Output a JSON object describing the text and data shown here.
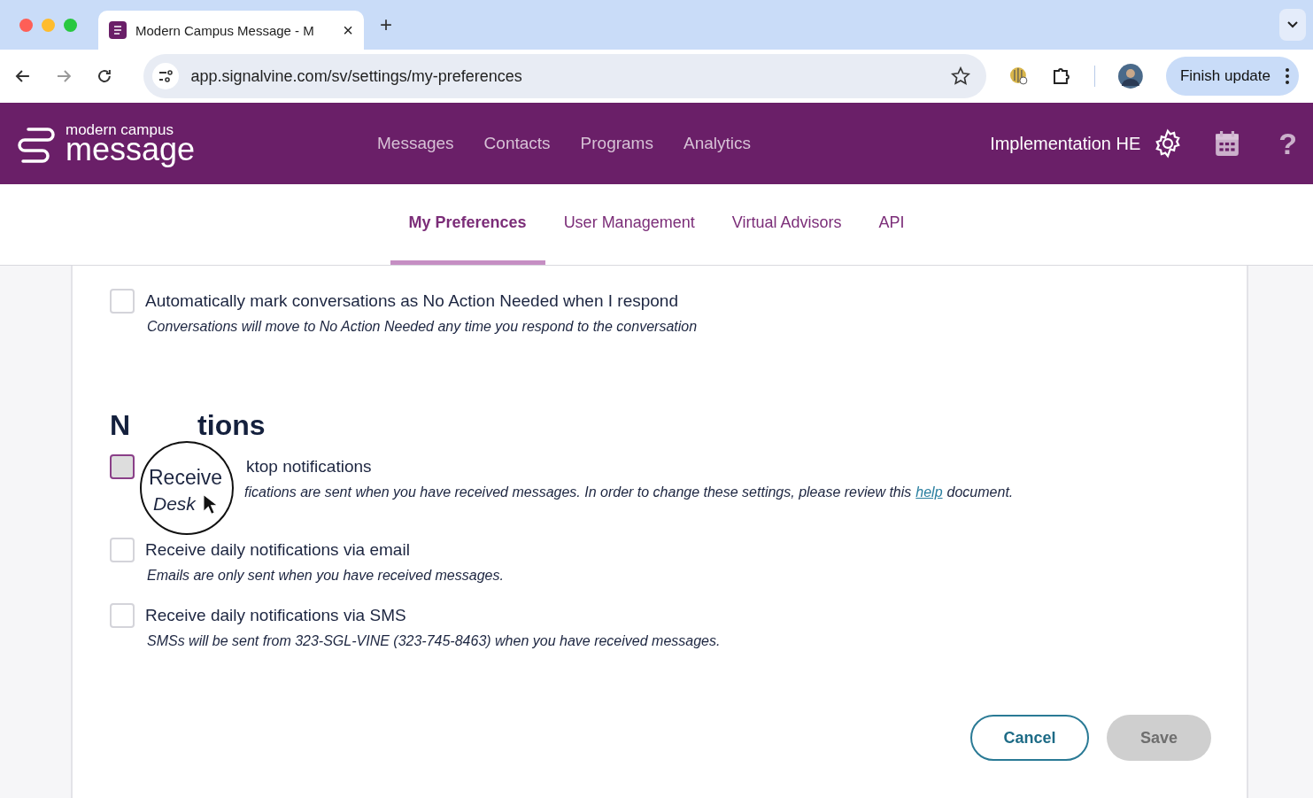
{
  "browser": {
    "tab_title": "Modern Campus Message - M",
    "tab_close": "×",
    "new_tab": "+",
    "url": "app.signalvine.com/sv/settings/my-preferences",
    "update_button": "Finish update"
  },
  "header": {
    "brand_small": "modern campus",
    "brand_large": "message",
    "nav": [
      {
        "label": "Messages"
      },
      {
        "label": "Contacts"
      },
      {
        "label": "Programs"
      },
      {
        "label": "Analytics"
      }
    ],
    "org": "Implementation HE",
    "help": "?"
  },
  "subtabs": [
    {
      "label": "My Preferences",
      "selected": true
    },
    {
      "label": "User Management",
      "selected": false
    },
    {
      "label": "Virtual Advisors",
      "selected": false
    },
    {
      "label": "API",
      "selected": false
    }
  ],
  "settings": [
    {
      "label": "Automatically mark conversations as No Action Needed when I respond",
      "description": "Conversations will move to No Action Needed any time you respond to the conversation",
      "checked": false
    }
  ],
  "notifications": {
    "heading_start": "N",
    "heading_end": "tions",
    "items": [
      {
        "kind": "covered",
        "label": "ktop notifications",
        "description": "fications are sent when you have received messages. In order to change these settings, please review this",
        "link": "help",
        "description_end": "document.",
        "checked": false,
        "focused": true
      },
      {
        "kind": "plain",
        "label": "Receive daily notifications via email",
        "description": "Emails are only sent when you have received messages.",
        "checked": false,
        "focused": false
      },
      {
        "kind": "plain",
        "label": "Receive daily notifications via SMS",
        "description": "SMSs will be sent from 323-SGL-VINE (323-745-8463) when you have received messages.",
        "checked": false,
        "focused": false
      }
    ]
  },
  "magnifier": {
    "lines": [
      "Receive",
      "Desk"
    ]
  },
  "buttons": {
    "cancel": "Cancel",
    "save": "Save",
    "save_disabled": true
  }
}
